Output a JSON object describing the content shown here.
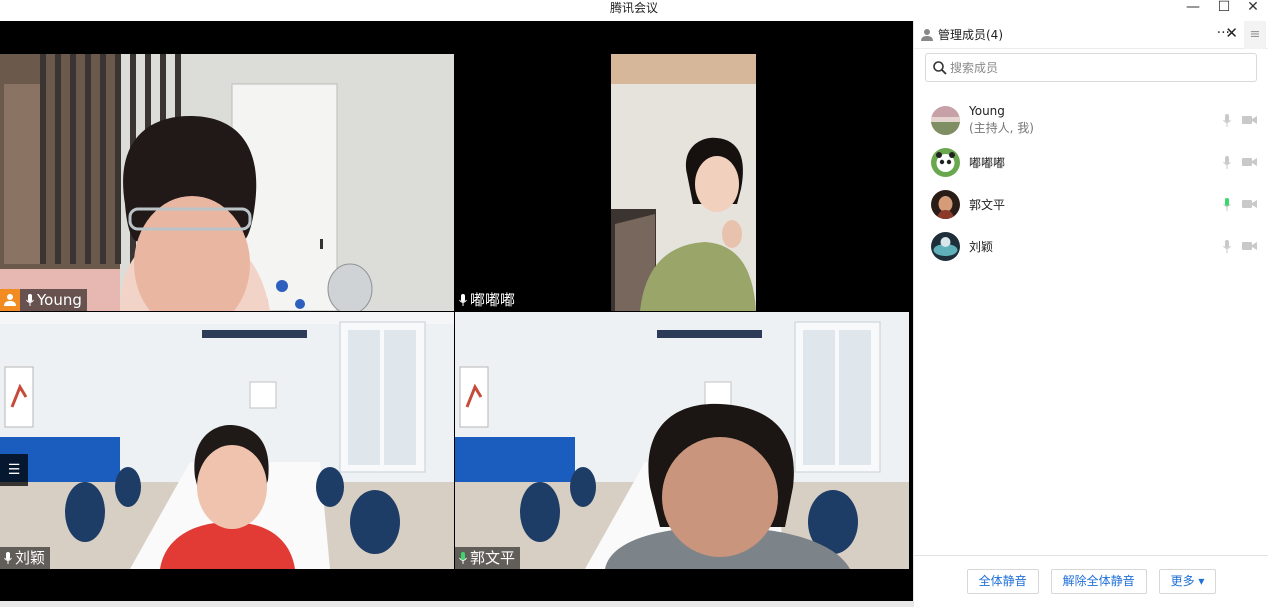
{
  "window": {
    "title": "腾讯会议",
    "minimize_label": "—",
    "maximize_label": "☐",
    "close_label": "✕"
  },
  "video_grid": {
    "tiles": [
      {
        "name": "Young",
        "is_host": true,
        "mic": "unmuted"
      },
      {
        "name": "嘟嘟嘟",
        "is_host": false,
        "mic": "unmuted"
      },
      {
        "name": "刘颖",
        "is_host": false,
        "mic": "unmuted"
      },
      {
        "name": "郭文平",
        "is_host": false,
        "mic": "unmuted",
        "active_speaker": true
      }
    ],
    "list_toggle_icon": "list-icon"
  },
  "members_panel": {
    "title": "管理成员(4)",
    "more_label": "···",
    "close_label": "✕",
    "menu_label": "≡",
    "search_placeholder": "搜索成员",
    "members": [
      {
        "name": "Young",
        "sub": "(主持人, 我)",
        "mic": "muted-gray",
        "cam": "off"
      },
      {
        "name": "嘟嘟嘟",
        "sub": "",
        "mic": "muted-gray",
        "cam": "off"
      },
      {
        "name": "郭文平",
        "sub": "",
        "mic": "speaking-green",
        "cam": "off"
      },
      {
        "name": "刘颖",
        "sub": "",
        "mic": "muted-gray",
        "cam": "off"
      }
    ],
    "footer": {
      "mute_all": "全体静音",
      "unmute_all": "解除全体静音",
      "more": "更多 ▾"
    },
    "colors": {
      "accent": "#1e6fd9",
      "speaking": "#2fb86b",
      "host_badge": "#f28b21"
    }
  }
}
